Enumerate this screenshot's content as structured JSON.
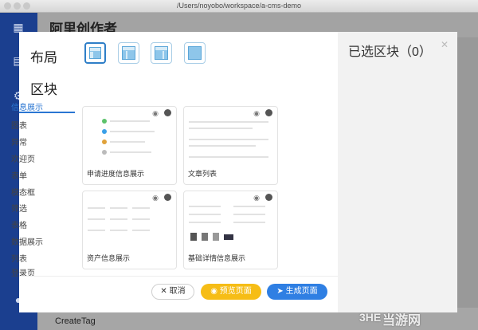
{
  "window": {
    "title": "/Users/noyobo/workspace/a-cms-demo"
  },
  "background": {
    "app_title": "阿里创作者",
    "bottom_item": "CreateTag"
  },
  "modal": {
    "layout_title": "布局",
    "block_title": "区块",
    "categories": [
      "信息展示",
      "图表",
      "异常",
      "欢迎页",
      "表单",
      "模态框",
      "筛选",
      "表格",
      "数据展示",
      "列表",
      "登录页"
    ],
    "active_category": "信息展示",
    "cards": [
      {
        "label": "申请进度信息展示"
      },
      {
        "label": "文章列表"
      },
      {
        "label": "资产信息展示"
      },
      {
        "label": "基础详情信息展示"
      }
    ],
    "buttons": {
      "cancel": "取消",
      "preview": "预览页面",
      "generate": "生成页面"
    }
  },
  "right_panel": {
    "title": "已选区块（0）"
  },
  "icons": {
    "preview": "eye-icon",
    "source": "github-icon",
    "close": "close-icon",
    "cancel": "x-icon",
    "send": "send-icon"
  },
  "colors": {
    "primary": "#2f7fe3",
    "warning": "#f6bd16",
    "sidebar": "#1b3f8f",
    "active_tab": "#2a76d2"
  },
  "watermark": {
    "logo": "3HE",
    "text": "当游网"
  }
}
